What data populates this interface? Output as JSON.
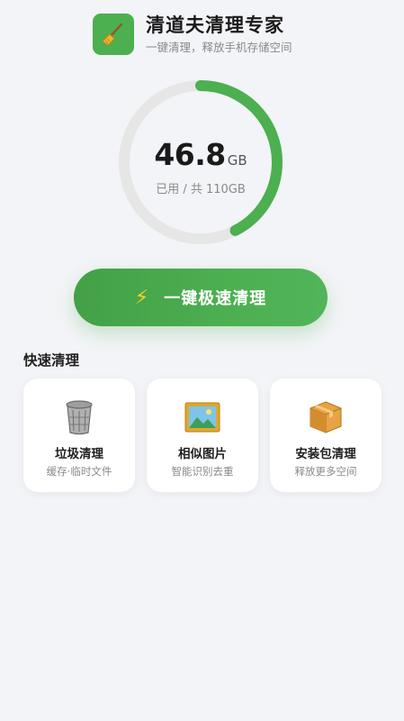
{
  "app": {
    "title": "清道夫清理专家",
    "subtitle": "一键清理，释放手机存储空间",
    "icon": "broom-icon",
    "accent": "#4caf50"
  },
  "storage": {
    "used_value": "46.8",
    "used_unit": "GB",
    "summary": "已用 / 共 110GB",
    "used_fraction": 0.425,
    "ring_color": "#4caf50",
    "track_color": "#e6e6e6"
  },
  "clean_button": {
    "label": "一键极速清理",
    "icon": "lightning-icon"
  },
  "quick_clean": {
    "title": "快速清理",
    "items": [
      {
        "label": "垃圾清理",
        "desc": "缓存·临时文件",
        "icon": "trash-can-icon"
      },
      {
        "label": "相似图片",
        "desc": "智能识别去重",
        "icon": "picture-icon"
      },
      {
        "label": "安装包清理",
        "desc": "释放更多空间",
        "icon": "package-icon"
      }
    ]
  }
}
